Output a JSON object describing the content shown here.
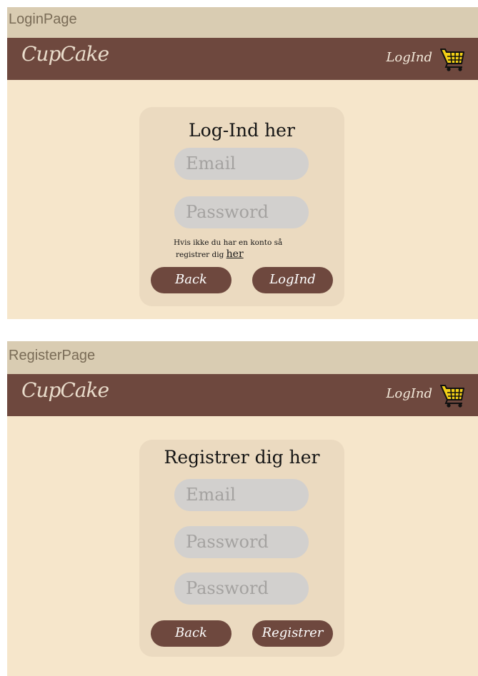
{
  "login_frame": {
    "label": "LoginPage",
    "navbar": {
      "logo": "CupCake",
      "login_link": "LogInd",
      "cart_icon": "shopping-cart"
    },
    "card": {
      "title": "Log-Ind her",
      "email_placeholder": "Email",
      "password_placeholder": "Password",
      "hint_line1": "Hvis ikke du har en konto så",
      "hint_line2": "registrer dig",
      "hint_link": "her",
      "back_button": "Back",
      "submit_button": "LogInd"
    }
  },
  "register_frame": {
    "label": "RegisterPage",
    "navbar": {
      "logo": "CupCake",
      "login_link": "LogInd",
      "cart_icon": "shopping-cart"
    },
    "card": {
      "title": "Registrer dig her",
      "email_placeholder": "Email",
      "password_placeholder": "Password",
      "password_repeat_placeholder": "Password",
      "back_button": "Back",
      "submit_button": "Registrer"
    }
  },
  "colors": {
    "frame_label_bg": "#d9ccb2",
    "page_bg": "#f6e6cb",
    "navbar_bg": "#6e483e",
    "card_bg": "#ebdac0",
    "field_bg": "#d2d0ce",
    "button_bg": "#6e483e",
    "cart_yellow": "#f2cf16"
  }
}
